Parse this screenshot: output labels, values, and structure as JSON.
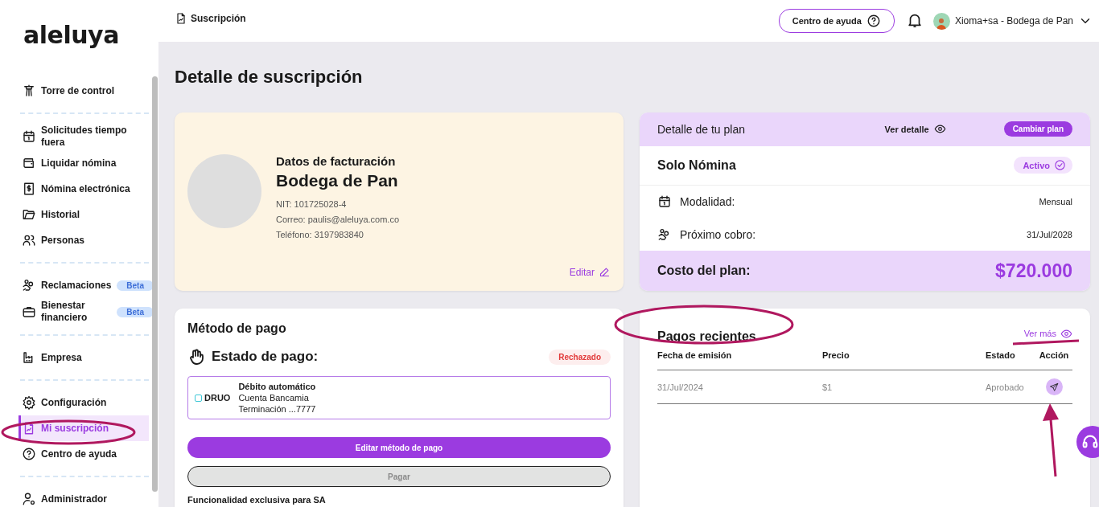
{
  "sidebar": {
    "logo": "aleluya",
    "sections": [
      {
        "items": [
          {
            "label": "Torre de control",
            "selected": false
          }
        ]
      },
      {
        "items": [
          {
            "label": "Solicitudes tiempo fuera",
            "selected": false
          },
          {
            "label": "Liquidar nómina",
            "selected": false
          },
          {
            "label": "Nómina electrónica",
            "selected": false
          },
          {
            "label": "Historial",
            "selected": false
          },
          {
            "label": "Personas",
            "selected": false
          }
        ]
      },
      {
        "items": [
          {
            "label": "Reclamaciones",
            "badge": "Beta",
            "selected": false
          },
          {
            "label": "Bienestar financiero",
            "badge": "Beta",
            "selected": false
          }
        ]
      },
      {
        "items": [
          {
            "label": "Empresa",
            "selected": false
          }
        ]
      },
      {
        "items": [
          {
            "label": "Configuración",
            "selected": false
          },
          {
            "label": "Mi suscripción",
            "selected": true
          },
          {
            "label": "Centro de ayuda",
            "selected": false
          }
        ]
      },
      {
        "items": [
          {
            "label": "Administrador",
            "selected": false
          }
        ]
      }
    ]
  },
  "topbar": {
    "breadcrumb": "Suscripción",
    "help_button": "Centro de ayuda",
    "user": "Xioma+sa - Bodega de Pan"
  },
  "page_title": "Detalle de suscripción",
  "billing": {
    "title": "Datos de facturación",
    "company": "Bodega de Pan",
    "nit": "NIT: 101725028-4",
    "email": "Correo: paulis@aleluya.com.co",
    "phone": "Teléfono: 3197983840",
    "edit_link": "Editar"
  },
  "plan": {
    "header": "Detalle de tu plan",
    "detail_link": "Ver detalle",
    "change_button": "Cambiar plan",
    "name": "Solo Nómina",
    "status": "Activo",
    "rows": [
      {
        "label": "Modalidad:",
        "value": "Mensual"
      },
      {
        "label": "Próximo cobro:",
        "value": "31/Jul/2028"
      }
    ],
    "cost_label": "Costo del plan:",
    "cost": "$720.000"
  },
  "payment_method": {
    "title": "Método de pago",
    "status_label": "Estado de pago:",
    "status": "Rechazado",
    "provider": "DRUO",
    "method": "Débito automático",
    "account": "Cuenta Bancamia",
    "ending": "Terminación ...7777",
    "edit_button": "Editar método de pago",
    "pay_button": {
      "label": "Pagar",
      "disabled": true
    },
    "note": "Funcionalidad exclusiva para SA"
  },
  "recent_payments": {
    "title": "Pagos recientes",
    "more_link": "Ver más",
    "columns": [
      "Fecha de emisión",
      "Precio",
      "Estado",
      "Acción"
    ],
    "rows": [
      {
        "date": "31/Jul/2024",
        "price": "$1",
        "status": "Aprobado"
      }
    ]
  }
}
